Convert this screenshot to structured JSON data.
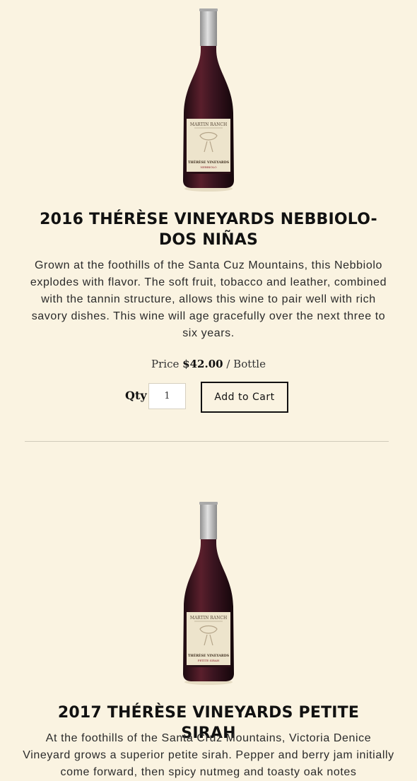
{
  "products": [
    {
      "title": "2016 THÉRÈSE VINEYARDS NEBBIOLO-DOS NIÑAS",
      "description": "Grown at the foothills of the Santa Cuz Mountains, this Nebbiolo explodes with flavor. The soft fruit, tobacco and leather, combined with the tannin structure, allows this wine to pair well with rich savory dishes. This wine will age gracefully over the next three to six years.",
      "price_label": "Price",
      "price": "$42.00",
      "unit": "/ Bottle",
      "qty_label": "Qty",
      "qty_value": "1",
      "cart_label": "Add to Cart",
      "bottle": {
        "brand": "MARTIN RANCH",
        "vineyard": "THÉRÈSE VINEYARDS",
        "varietal": "NEBBIOLO"
      }
    },
    {
      "title": "2017 THÉRÈSE VINEYARDS PETITE SIRAH",
      "description": "At the foothills of the Santa Cruz Mountains, Victoria Denice Vineyard grows a superior petite sirah. Pepper and berry jam initially come forward, then spicy nutmeg and toasty oak notes",
      "bottle": {
        "brand": "MARTIN RANCH",
        "vineyard": "THÉRÈSE VINEYARDS",
        "varietal": "PETITE SIRAH"
      }
    }
  ],
  "colors": {
    "background": "#faf3e1",
    "wine": "#3a1420",
    "capsule": "#b9b9b9",
    "label": "#ede4cc",
    "accent": "#8b1e2a"
  }
}
